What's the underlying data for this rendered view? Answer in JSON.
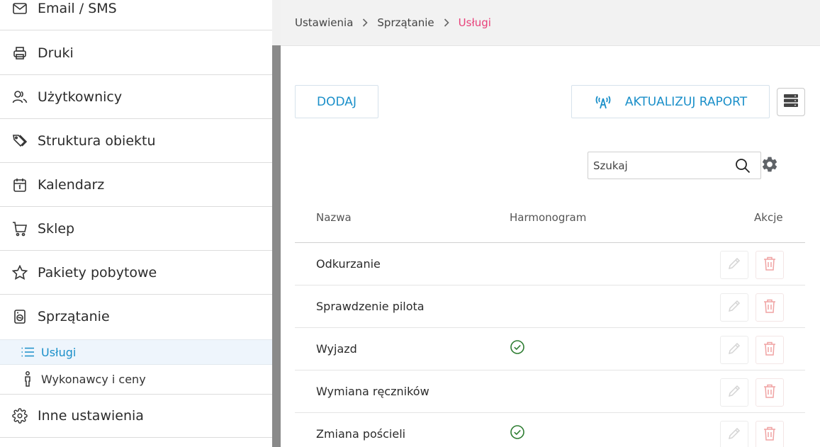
{
  "sidebar": {
    "items": [
      {
        "label": "Email / SMS",
        "icon": "envelope-icon"
      },
      {
        "label": "Druki",
        "icon": "printer-icon"
      },
      {
        "label": "Użytkownicy",
        "icon": "users-icon"
      },
      {
        "label": "Struktura obiektu",
        "icon": "tags-icon"
      },
      {
        "label": "Kalendarz",
        "icon": "calendar-icon"
      },
      {
        "label": "Sklep",
        "icon": "cart-icon"
      },
      {
        "label": "Pakiety pobytowe",
        "icon": "star-icon"
      },
      {
        "label": "Sprzątanie",
        "icon": "washing-machine-icon"
      }
    ],
    "subitems": [
      {
        "label": "Usługi",
        "icon": "list-icon",
        "active": true
      },
      {
        "label": "Wykonawcy i ceny",
        "icon": "person-icon",
        "active": false
      }
    ],
    "bottom_item": {
      "label": "Inne ustawienia",
      "icon": "gear-icon"
    }
  },
  "breadcrumb": {
    "items": [
      "Ustawienia",
      "Sprzątanie",
      "Usługi"
    ]
  },
  "toolbar": {
    "add_label": "DODAJ",
    "report_label": "AKTUALIZUJ RAPORT"
  },
  "search": {
    "placeholder": "Szukaj"
  },
  "table": {
    "columns": [
      "Nazwa",
      "Harmonogram",
      "Akcje"
    ],
    "rows": [
      {
        "name": "Odkurzanie",
        "schedule": false
      },
      {
        "name": "Sprawdzenie pilota",
        "schedule": false
      },
      {
        "name": "Wyjazd",
        "schedule": true
      },
      {
        "name": "Wymiana ręczników",
        "schedule": false
      },
      {
        "name": "Zmiana pościeli",
        "schedule": true
      }
    ]
  },
  "colors": {
    "accent": "#1a8fc9",
    "breadcrumb_current": "#e8417a",
    "check_green": "#2e7d32",
    "delete_red": "#f0a3a3"
  }
}
